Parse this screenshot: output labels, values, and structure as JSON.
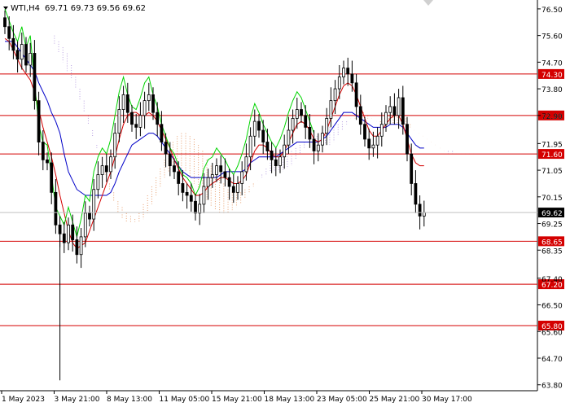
{
  "header": {
    "title": "WTI,H4",
    "ohlc": "69.71 69.73 69.56 69.62"
  },
  "colors": {
    "background": "#ffffff",
    "axis": "#000000",
    "candle": "#000000",
    "level_line": "#d40000",
    "level_label_bg": "#d40000",
    "level_label_text": "#ffffff",
    "price_tag_bg": "#000000",
    "price_tag_text": "#ffffff",
    "tenkan": "#d40000",
    "kijun": "#0000c8",
    "chikou": "#00d400",
    "cloud_bull": "#e8a070",
    "cloud_bear": "#b8a0e0"
  },
  "chart_data": {
    "type": "candlestick",
    "symbol": "WTI",
    "timeframe": "H4",
    "ylim": [
      63.6,
      76.8
    ],
    "y_ticks": [
      "76.50",
      "75.60",
      "74.70",
      "73.80",
      "72.90",
      "71.95",
      "71.05",
      "70.15",
      "69.25",
      "68.35",
      "67.40",
      "66.50",
      "65.60",
      "64.70",
      "63.80"
    ],
    "x_ticks": [
      "1 May 2023",
      "3 May 21:00",
      "8 May 13:00",
      "11 May 05:00",
      "15 May 21:00",
      "18 May 13:00",
      "23 May 05:00",
      "25 May 21:00",
      "30 May 17:00"
    ],
    "last_price": "69.62",
    "levels": [
      {
        "label": "74.30",
        "value": 74.3
      },
      {
        "label": "72.90",
        "value": 72.9
      },
      {
        "label": "71.60",
        "value": 71.6
      },
      {
        "label": "68.65",
        "value": 68.65
      },
      {
        "label": "67.20",
        "value": 67.2
      },
      {
        "label": "65.80",
        "value": 65.8
      }
    ],
    "indicator": "Ichimoku Kinko Hyo",
    "closes": [
      75.9,
      75.5,
      75.1,
      74.8,
      75.3,
      74.6,
      75.0,
      73.4,
      72.0,
      71.4,
      71.3,
      70.3,
      69.2,
      68.9,
      68.6,
      69.2,
      68.7,
      68.2,
      68.8,
      69.6,
      69.4,
      70.4,
      70.9,
      71.2,
      71.0,
      71.5,
      72.3,
      73.1,
      73.6,
      73.0,
      72.6,
      72.5,
      72.9,
      73.4,
      73.6,
      73.0,
      72.6,
      72.0,
      71.6,
      71.2,
      71.0,
      70.6,
      70.3,
      70.2,
      70.0,
      69.6,
      69.9,
      70.5,
      70.8,
      70.9,
      71.2,
      71.0,
      70.8,
      70.5,
      70.3,
      70.6,
      71.0,
      71.5,
      72.2,
      72.7,
      72.4,
      72.0,
      71.7,
      71.4,
      71.2,
      71.5,
      71.9,
      72.4,
      72.8,
      73.1,
      72.9,
      72.5,
      72.1,
      71.7,
      71.9,
      72.3,
      72.8,
      73.4,
      73.8,
      74.2,
      74.5,
      74.3,
      74.0,
      73.2,
      72.6,
      72.1,
      71.8,
      71.9,
      72.2,
      72.6,
      73.0,
      73.2,
      72.9,
      73.5,
      72.6,
      71.6,
      70.6,
      69.9,
      69.5,
      69.62
    ],
    "tenkan": [
      75.5,
      75.4,
      75.1,
      74.8,
      74.5,
      74.3,
      74.1,
      73.7,
      73.1,
      72.5,
      72.0,
      71.5,
      70.9,
      70.2,
      69.6,
      69.0,
      68.6,
      68.4,
      68.5,
      68.6,
      69.0,
      69.4,
      69.8,
      70.2,
      70.6,
      71.0,
      71.5,
      72.1,
      72.6,
      72.9,
      73.0,
      73.0,
      72.9,
      72.9,
      73.0,
      72.9,
      72.7,
      72.4,
      72.1,
      71.8,
      71.4,
      71.1,
      70.8,
      70.6,
      70.4,
      70.2,
      70.2,
      70.3,
      70.5,
      70.6,
      70.7,
      70.8,
      70.8,
      70.7,
      70.6,
      70.6,
      70.7,
      70.9,
      71.3,
      71.7,
      71.9,
      71.9,
      71.8,
      71.6,
      71.5,
      71.5,
      71.7,
      72.0,
      72.3,
      72.6,
      72.7,
      72.6,
      72.4,
      72.1,
      72.0,
      72.1,
      72.4,
      72.8,
      73.2,
      73.6,
      73.9,
      74.0,
      73.9,
      73.6,
      73.2,
      72.8,
      72.4,
      72.2,
      72.2,
      72.4,
      72.6,
      72.8,
      72.9,
      72.9,
      72.6,
      72.1,
      71.6,
      71.3,
      71.2,
      71.2
    ],
    "kijun": [
      75.4,
      75.4,
      75.4,
      75.2,
      75.0,
      74.8,
      74.6,
      74.4,
      74.0,
      73.7,
      73.4,
      73.0,
      72.7,
      72.3,
      71.6,
      71.0,
      70.7,
      70.4,
      70.3,
      70.2,
      70.2,
      70.2,
      70.2,
      70.2,
      70.2,
      70.3,
      70.6,
      71.0,
      71.3,
      71.6,
      71.9,
      72.0,
      72.1,
      72.2,
      72.3,
      72.3,
      72.2,
      72.0,
      71.8,
      71.6,
      71.4,
      71.2,
      71.0,
      70.9,
      70.8,
      70.8,
      70.8,
      70.8,
      70.8,
      70.8,
      70.8,
      70.9,
      71.0,
      71.0,
      71.0,
      71.0,
      71.0,
      71.1,
      71.3,
      71.4,
      71.5,
      71.5,
      71.5,
      71.5,
      71.5,
      71.6,
      71.7,
      71.8,
      71.9,
      72.0,
      72.0,
      72.0,
      72.0,
      72.0,
      72.0,
      72.1,
      72.2,
      72.4,
      72.6,
      72.8,
      73.0,
      73.0,
      73.0,
      72.9,
      72.8,
      72.7,
      72.6,
      72.5,
      72.5,
      72.5,
      72.5,
      72.6,
      72.6,
      72.6,
      72.5,
      72.3,
      72.1,
      71.9,
      71.8,
      71.8
    ],
    "senkou_a": [
      75.3,
      75.0,
      74.7,
      74.4,
      74.1,
      73.8,
      73.4,
      73.0,
      72.6,
      72.2,
      71.8,
      71.4,
      71.0,
      70.6,
      70.3,
      70.0,
      69.8,
      69.6,
      69.5,
      69.4,
      69.6,
      69.9,
      70.2,
      70.5,
      70.8,
      71.1,
      71.4,
      71.7,
      72.0,
      72.2,
      72.3,
      72.3,
      72.2,
      72.1,
      71.9,
      71.7,
      71.4,
      71.2,
      71.0,
      70.8,
      70.6,
      70.4,
      70.3,
      70.3,
      70.3,
      70.4,
      70.5,
      70.6,
      70.7,
      70.8,
      70.9,
      71.0,
      71.0,
      71.0,
      71.0,
      71.1,
      71.2,
      71.4,
      71.6,
      71.8,
      72.0,
      72.1,
      72.1,
      72.0,
      71.9,
      71.9,
      72.0,
      72.2,
      72.4,
      72.6,
      72.8,
      72.9,
      73.0,
      73.0,
      72.9,
      72.8,
      72.7,
      72.7,
      72.8,
      72.9,
      73.0,
      73.0,
      72.9,
      72.8,
      72.6,
      72.4,
      72.3,
      72.2,
      72.1,
      72.0,
      71.9,
      71.8,
      71.7,
      71.6,
      71.6,
      71.6,
      71.6,
      71.6,
      71.6,
      71.6
    ],
    "senkou_b": [
      75.6,
      75.4,
      75.2,
      75.0,
      74.6,
      74.2,
      73.8,
      73.4,
      72.9,
      72.4,
      71.9,
      71.4,
      70.9,
      70.4,
      70.0,
      69.6,
      69.4,
      69.3,
      69.3,
      69.3,
      69.3,
      69.4,
      69.6,
      69.9,
      70.2,
      70.5,
      70.8,
      71.0,
      71.2,
      71.2,
      71.1,
      71.0,
      70.8,
      70.6,
      70.4,
      70.2,
      70.0,
      69.8,
      69.7,
      69.6,
      69.6,
      69.6,
      69.7,
      69.8,
      69.9,
      70.1,
      70.3,
      70.5,
      70.7,
      70.9,
      71.1,
      71.3,
      71.4,
      71.5,
      71.5,
      71.6,
      71.7,
      71.8,
      71.9,
      72.0,
      72.1,
      72.2,
      72.2,
      72.3,
      72.4,
      72.5,
      72.5,
      72.6,
      72.7,
      72.7,
      72.8,
      72.8,
      72.9,
      72.9,
      72.8,
      72.8,
      72.7,
      72.6,
      72.6,
      72.6,
      72.6,
      72.6,
      72.6,
      72.5,
      72.5,
      72.4,
      72.3,
      72.2,
      72.1,
      72.0,
      71.9,
      71.8,
      71.7,
      71.7,
      71.7,
      71.6,
      71.6,
      71.6,
      71.6,
      71.6
    ]
  }
}
